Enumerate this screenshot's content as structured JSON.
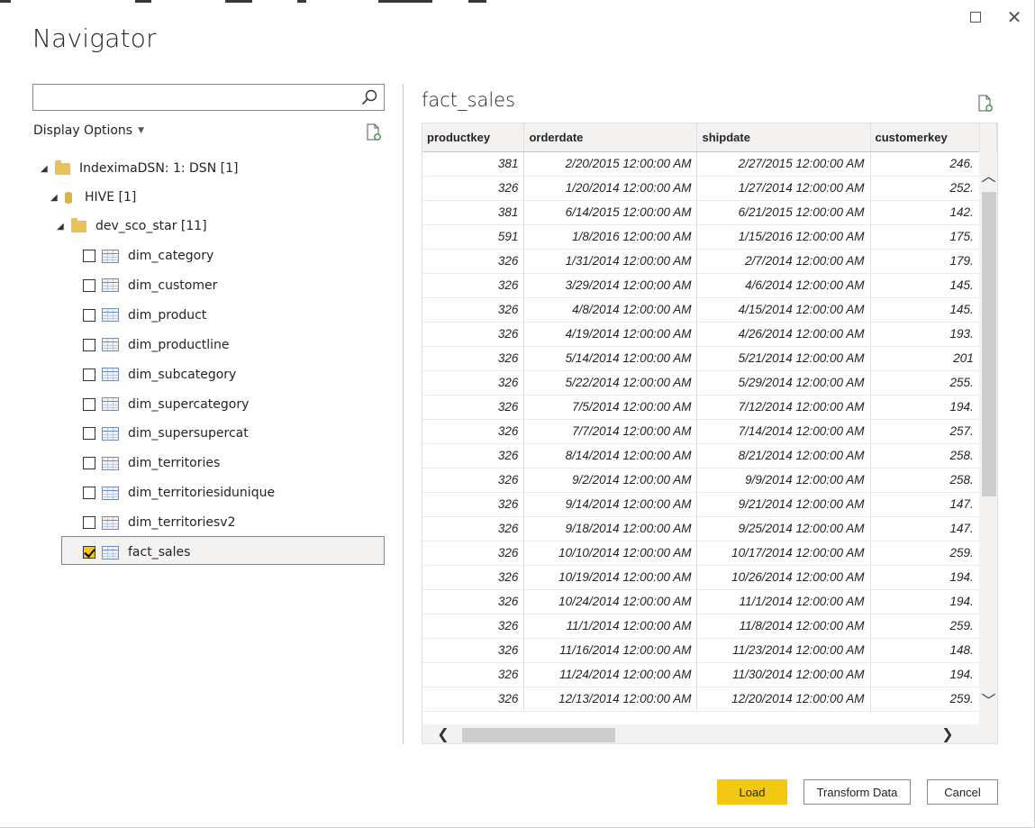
{
  "window": {
    "title": "Navigator",
    "maximize_label": "□",
    "close_label": "✕"
  },
  "left_panel": {
    "search": {
      "value": "",
      "placeholder": ""
    },
    "display_options_label": "Display Options",
    "tree": [
      {
        "label": "IndeximaDSN: 1: DSN [1]",
        "kind": "folder"
      },
      {
        "label": "HIVE [1]",
        "kind": "database"
      },
      {
        "label": "dev_sco_star [11]",
        "kind": "folder"
      },
      {
        "label": "dim_category",
        "kind": "table",
        "checked": false
      },
      {
        "label": "dim_customer",
        "kind": "table",
        "checked": false
      },
      {
        "label": "dim_product",
        "kind": "table",
        "checked": false
      },
      {
        "label": "dim_productline",
        "kind": "table",
        "checked": false
      },
      {
        "label": "dim_subcategory",
        "kind": "table",
        "checked": false
      },
      {
        "label": "dim_supercategory",
        "kind": "table",
        "checked": false
      },
      {
        "label": "dim_supersupercat",
        "kind": "table",
        "checked": false
      },
      {
        "label": "dim_territories",
        "kind": "table",
        "checked": false
      },
      {
        "label": "dim_territoriesidunique",
        "kind": "table",
        "checked": false
      },
      {
        "label": "dim_territoriesv2",
        "kind": "table",
        "checked": false
      },
      {
        "label": "fact_sales",
        "kind": "table",
        "checked": true
      }
    ]
  },
  "preview": {
    "title": "fact_sales",
    "columns": [
      "productkey",
      "orderdate",
      "shipdate",
      "customerkey"
    ],
    "rows": [
      [
        "381",
        "2/20/2015 12:00:00 AM",
        "2/27/2015 12:00:00 AM",
        "246."
      ],
      [
        "326",
        "1/20/2014 12:00:00 AM",
        "1/27/2014 12:00:00 AM",
        "252."
      ],
      [
        "381",
        "6/14/2015 12:00:00 AM",
        "6/21/2015 12:00:00 AM",
        "142."
      ],
      [
        "591",
        "1/8/2016 12:00:00 AM",
        "1/15/2016 12:00:00 AM",
        "175."
      ],
      [
        "326",
        "1/31/2014 12:00:00 AM",
        "2/7/2014 12:00:00 AM",
        "179."
      ],
      [
        "326",
        "3/29/2014 12:00:00 AM",
        "4/6/2014 12:00:00 AM",
        "145."
      ],
      [
        "326",
        "4/8/2014 12:00:00 AM",
        "4/15/2014 12:00:00 AM",
        "145."
      ],
      [
        "326",
        "4/19/2014 12:00:00 AM",
        "4/26/2014 12:00:00 AM",
        "193."
      ],
      [
        "326",
        "5/14/2014 12:00:00 AM",
        "5/21/2014 12:00:00 AM",
        "201"
      ],
      [
        "326",
        "5/22/2014 12:00:00 AM",
        "5/29/2014 12:00:00 AM",
        "255."
      ],
      [
        "326",
        "7/5/2014 12:00:00 AM",
        "7/12/2014 12:00:00 AM",
        "194."
      ],
      [
        "326",
        "7/7/2014 12:00:00 AM",
        "7/14/2014 12:00:00 AM",
        "257."
      ],
      [
        "326",
        "8/14/2014 12:00:00 AM",
        "8/21/2014 12:00:00 AM",
        "258."
      ],
      [
        "326",
        "9/2/2014 12:00:00 AM",
        "9/9/2014 12:00:00 AM",
        "258."
      ],
      [
        "326",
        "9/14/2014 12:00:00 AM",
        "9/21/2014 12:00:00 AM",
        "147."
      ],
      [
        "326",
        "9/18/2014 12:00:00 AM",
        "9/25/2014 12:00:00 AM",
        "147."
      ],
      [
        "326",
        "10/10/2014 12:00:00 AM",
        "10/17/2014 12:00:00 AM",
        "259."
      ],
      [
        "326",
        "10/19/2014 12:00:00 AM",
        "10/26/2014 12:00:00 AM",
        "194."
      ],
      [
        "326",
        "10/24/2014 12:00:00 AM",
        "11/1/2014 12:00:00 AM",
        "194."
      ],
      [
        "326",
        "11/1/2014 12:00:00 AM",
        "11/8/2014 12:00:00 AM",
        "259."
      ],
      [
        "326",
        "11/16/2014 12:00:00 AM",
        "11/23/2014 12:00:00 AM",
        "148."
      ],
      [
        "326",
        "11/24/2014 12:00:00 AM",
        "11/30/2014 12:00:00 AM",
        "194."
      ],
      [
        "326",
        "12/13/2014 12:00:00 AM",
        "12/20/2014 12:00:00 AM",
        "259."
      ]
    ]
  },
  "buttons": {
    "load": "Load",
    "transform": "Transform Data",
    "cancel": "Cancel"
  },
  "colors": {
    "accent": "#f2c811",
    "folder": "#e8c15a",
    "border": "#8a8886"
  }
}
